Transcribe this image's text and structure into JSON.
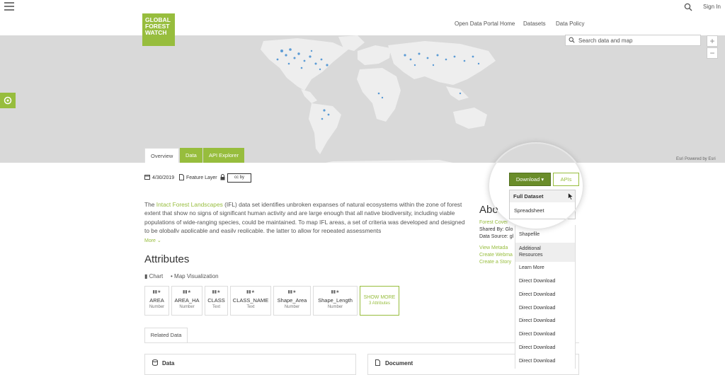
{
  "header": {
    "logo_lines": [
      "GLOBAL",
      "FOREST",
      "WATCH"
    ],
    "nav": [
      "Open Data Portal Home",
      "Datasets",
      "Data Policy"
    ],
    "sign_in": "Sign In"
  },
  "map": {
    "search_placeholder": "Search data and map",
    "zoom_in": "+",
    "zoom_out": "−",
    "attribution": "Esri   Powered by Esri"
  },
  "tabs": [
    "Overview",
    "Data",
    "API Explorer"
  ],
  "meta": {
    "date": "4/30/2019",
    "layer_type": "Feature Layer",
    "license_badge": "cc by"
  },
  "intro": {
    "the": "The ",
    "link": "Intact Forest Landscapes",
    "rest": " (IFL) data set identifies unbroken expanses of natural ecosystems within the zone of forest extent that show no signs of significant human activity and are large enough that all native biodiversity, including viable populations of wide-ranging species, could be maintained. To map IFL areas, a set of criteria was developed and designed to be globally applicable and easily replicable, the latter to allow for repeated assessments"
  },
  "more_label": "More",
  "attributes": {
    "title": "Attributes",
    "chart_label": "Chart",
    "map_viz_label": "Map Visualization",
    "fields": [
      {
        "name": "AREA",
        "type": "Number"
      },
      {
        "name": "AREA_HA",
        "type": "Number"
      },
      {
        "name": "CLASS",
        "type": "Text"
      },
      {
        "name": "CLASS_NAME",
        "type": "Text"
      },
      {
        "name": "Shape_Area",
        "type": "Number"
      },
      {
        "name": "Shape_Length",
        "type": "Number"
      }
    ],
    "show_more": "SHOW MORE",
    "show_more_count": "3 Attributes"
  },
  "related": {
    "tab": "Related Data",
    "data_card": "Data",
    "document_card": "Document"
  },
  "about": {
    "title": "Abo",
    "category": "Forest Cover",
    "shared_by": "Shared By: Glo",
    "data_source": "Data Source: gl",
    "view_metadata": "View Metada",
    "create_webmap": "Create Webma",
    "create_story": "Create a Story"
  },
  "download": {
    "button": "Download",
    "apis": "APIs",
    "full_dataset": "Full Dataset",
    "spreadsheet": "Spreadsheet",
    "shapefile": "Shapefile",
    "additional_resources": [
      "Additional",
      "Resources"
    ],
    "learn_more": "Learn More",
    "direct_download": [
      "Direct Download",
      "Direct Download",
      "Direct Download",
      "Direct Download",
      "Direct Download",
      "Direct Download",
      "Direct Download"
    ]
  },
  "colors": {
    "brand_green": "#97bd3d",
    "dark_green": "#6a8d2a",
    "map_bg": "#d9d9d9",
    "land": "#eeeeee",
    "forest_blue": "#5b9bd5"
  }
}
